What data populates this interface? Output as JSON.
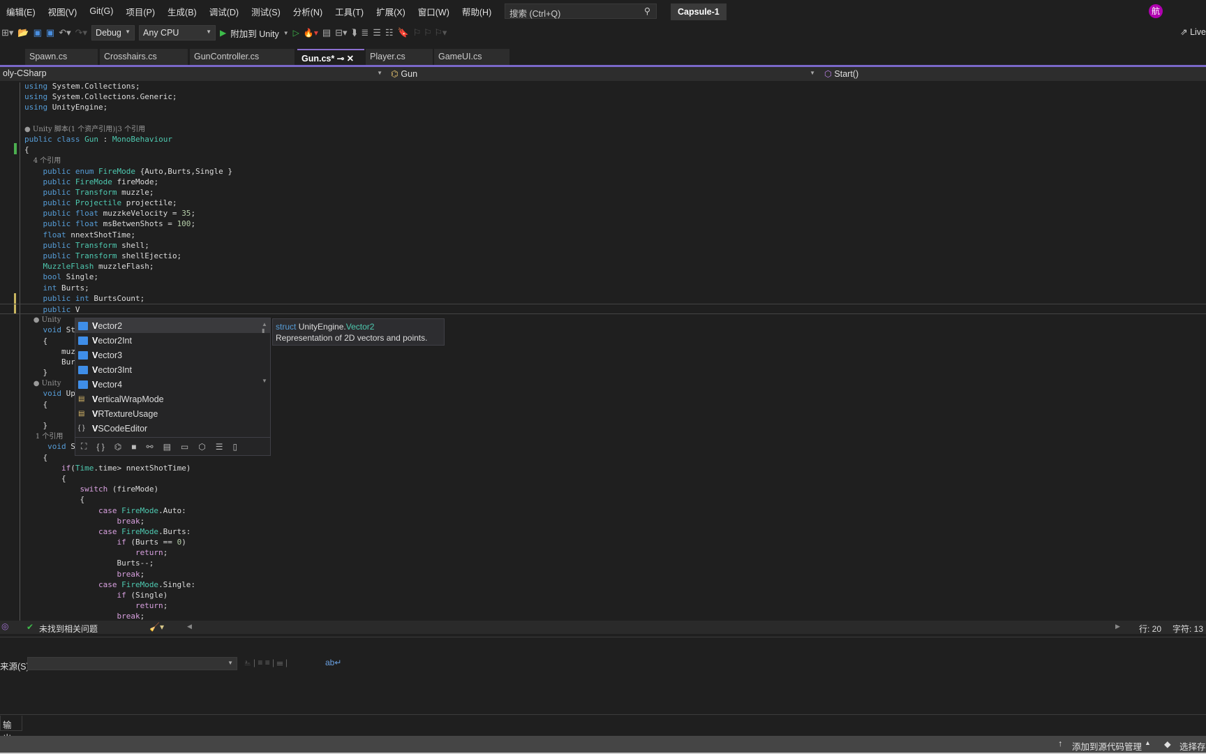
{
  "menu": [
    "编辑(E)",
    "视图(V)",
    "Git(G)",
    "项目(P)",
    "生成(B)",
    "调试(D)",
    "测试(S)",
    "分析(N)",
    "工具(T)",
    "扩展(X)",
    "窗口(W)",
    "帮助(H)"
  ],
  "search": {
    "placeholder": "搜索 (Ctrl+Q)"
  },
  "solution": "Capsule-1",
  "avatar": "航",
  "toolbar": {
    "config": "Debug",
    "platform": "Any CPU",
    "attach": "附加到 Unity",
    "live": "Live"
  },
  "tabs": [
    {
      "label": "Spawn.cs"
    },
    {
      "label": "Crosshairs.cs"
    },
    {
      "label": "GunController.cs"
    },
    {
      "label": "Gun.cs*",
      "active": true
    },
    {
      "label": "Player.cs"
    },
    {
      "label": "GameUI.cs"
    }
  ],
  "nav": {
    "project": "oly-CSharp",
    "class": "Gun",
    "member": "Start()"
  },
  "code": [
    [
      [
        "kw",
        "using "
      ],
      [
        "tx",
        "System.Collections;"
      ]
    ],
    [
      [
        "kw",
        "using "
      ],
      [
        "tx",
        "System.Collections.Generic;"
      ]
    ],
    [
      [
        "kw",
        "using "
      ],
      [
        "tx",
        "UnityEngine;"
      ]
    ],
    [],
    [
      [
        "lens",
        "● Unity 脚本(1 个资产引用)|3 个引用"
      ]
    ],
    [
      [
        "kw",
        "public class "
      ],
      [
        "ty",
        "Gun"
      ],
      [
        "tx",
        " : "
      ],
      [
        "ty",
        "MonoBehaviour"
      ]
    ],
    [
      [
        "tx",
        "{"
      ]
    ],
    [
      [
        "lens",
        "    4 个引用"
      ]
    ],
    [
      [
        "kw",
        "    public enum "
      ],
      [
        "ty",
        "FireMode"
      ],
      [
        "tx",
        " {Auto,Burts,Single }"
      ]
    ],
    [
      [
        "kw",
        "    public "
      ],
      [
        "ty",
        "FireMode"
      ],
      [
        "tx",
        " fireMode;"
      ]
    ],
    [
      [
        "kw",
        "    public "
      ],
      [
        "ty",
        "Transform"
      ],
      [
        "tx",
        " muzzle;"
      ]
    ],
    [
      [
        "kw",
        "    public "
      ],
      [
        "ty",
        "Projectile"
      ],
      [
        "tx",
        " projectile;"
      ]
    ],
    [
      [
        "kw",
        "    public float "
      ],
      [
        "tx",
        "muzzkeVelocity = "
      ],
      [
        "num",
        "35"
      ],
      [
        "tx",
        ";"
      ]
    ],
    [
      [
        "kw",
        "    public float "
      ],
      [
        "tx",
        "msBetwenShots = "
      ],
      [
        "num",
        "100"
      ],
      [
        "tx",
        ";"
      ]
    ],
    [
      [
        "kw",
        "    float "
      ],
      [
        "tx",
        "nnextShotTime;"
      ]
    ],
    [
      [
        "kw",
        "    public "
      ],
      [
        "ty",
        "Transform"
      ],
      [
        "tx",
        " shell;"
      ]
    ],
    [
      [
        "kw",
        "    public "
      ],
      [
        "ty",
        "Transform"
      ],
      [
        "tx",
        " shellEjectio;"
      ]
    ],
    [
      [
        "ty",
        "    MuzzleFlash"
      ],
      [
        "tx",
        " muzzleFlash;"
      ]
    ],
    [
      [
        "kw",
        "    bool "
      ],
      [
        "tx",
        "Single;"
      ]
    ],
    [
      [
        "kw",
        "    int "
      ],
      [
        "tx",
        "Burts;"
      ]
    ],
    [
      [
        "kw",
        "    public int "
      ],
      [
        "tx",
        "BurtsCount;"
      ]
    ],
    [
      [
        "kw",
        "    public "
      ],
      [
        "tx",
        "V"
      ]
    ],
    [
      [
        "lens",
        "    ● Unity"
      ]
    ],
    [
      [
        "kw",
        "    void "
      ],
      [
        "tx",
        "St"
      ]
    ],
    [
      [
        "tx",
        "    {"
      ]
    ],
    [
      [
        "tx",
        "        muz"
      ]
    ],
    [
      [
        "tx",
        "        Bur"
      ]
    ],
    [
      [
        "tx",
        "    }"
      ]
    ],
    [
      [
        "lens",
        "    ● Unity"
      ]
    ],
    [
      [
        "kw",
        "    void "
      ],
      [
        "tx",
        "Up"
      ]
    ],
    [
      [
        "tx",
        "    {"
      ]
    ],
    [],
    [
      [
        "tx",
        "    }"
      ]
    ],
    [
      [
        "lens",
        "     1 个引用"
      ]
    ],
    [
      [
        "kw",
        "     void "
      ],
      [
        "tx",
        "S"
      ]
    ],
    [
      [
        "tx",
        "    {"
      ]
    ],
    [
      [
        "ctl",
        "        if"
      ],
      [
        "tx",
        "("
      ],
      [
        "ty",
        "Time"
      ],
      [
        "tx",
        ".time> nnextShotTime)"
      ]
    ],
    [
      [
        "tx",
        "        {"
      ]
    ],
    [
      [
        "ctl",
        "            switch"
      ],
      [
        "tx",
        " (fireMode)"
      ]
    ],
    [
      [
        "tx",
        "            {"
      ]
    ],
    [
      [
        "ctl",
        "                case "
      ],
      [
        "ty",
        "FireMode"
      ],
      [
        "tx",
        ".Auto:"
      ]
    ],
    [
      [
        "ctl",
        "                    break"
      ],
      [
        "tx",
        ";"
      ]
    ],
    [
      [
        "ctl",
        "                case "
      ],
      [
        "ty",
        "FireMode"
      ],
      [
        "tx",
        ".Burts:"
      ]
    ],
    [
      [
        "ctl",
        "                    if"
      ],
      [
        "tx",
        " (Burts == "
      ],
      [
        "num",
        "0"
      ],
      [
        "tx",
        ")"
      ]
    ],
    [
      [
        "ctl",
        "                        return"
      ],
      [
        "tx",
        ";"
      ]
    ],
    [
      [
        "tx",
        "                    Burts--;"
      ]
    ],
    [
      [
        "ctl",
        "                    break"
      ],
      [
        "tx",
        ";"
      ]
    ],
    [
      [
        "ctl",
        "                case "
      ],
      [
        "ty",
        "FireMode"
      ],
      [
        "tx",
        ".Single:"
      ]
    ],
    [
      [
        "ctl",
        "                    if"
      ],
      [
        "tx",
        " (Single)"
      ]
    ],
    [
      [
        "ctl",
        "                        return"
      ],
      [
        "tx",
        ";"
      ]
    ],
    [
      [
        "ctl",
        "                    break"
      ],
      [
        "tx",
        ";"
      ]
    ]
  ],
  "current_row": 21,
  "completion": {
    "typed": "V",
    "items": [
      {
        "rest": "ector2",
        "icon": "struct-icon",
        "selected": true
      },
      {
        "rest": "ector2Int",
        "icon": "struct-icon"
      },
      {
        "rest": "ector3",
        "icon": "struct-icon"
      },
      {
        "rest": "ector3Int",
        "icon": "struct-icon"
      },
      {
        "rest": "ector4",
        "icon": "struct-icon"
      },
      {
        "rest": "erticalWrapMode",
        "icon": "enum-icon"
      },
      {
        "rest": "RTextureUsage",
        "icon": "enum-icon"
      },
      {
        "rest": "SCodeEditor",
        "icon": "namespace-icon"
      }
    ],
    "filters": [
      "⛶",
      "{ }",
      "⌬",
      "■",
      "⚯",
      "▤",
      "▭",
      "⬡",
      "☰",
      "▯"
    ]
  },
  "tooltip": {
    "kind": "struct",
    "ns": "UnityEngine.",
    "name": "Vector2",
    "desc": "Representation of 2D vectors and points."
  },
  "status": {
    "issues": "未找到相关问题",
    "line": "行: 20",
    "col": "字符: 13"
  },
  "output": {
    "source_label": "来源(S):",
    "tab": "输出"
  },
  "bottom": {
    "source_control": "添加到源代码管理",
    "repo": "选择存"
  }
}
